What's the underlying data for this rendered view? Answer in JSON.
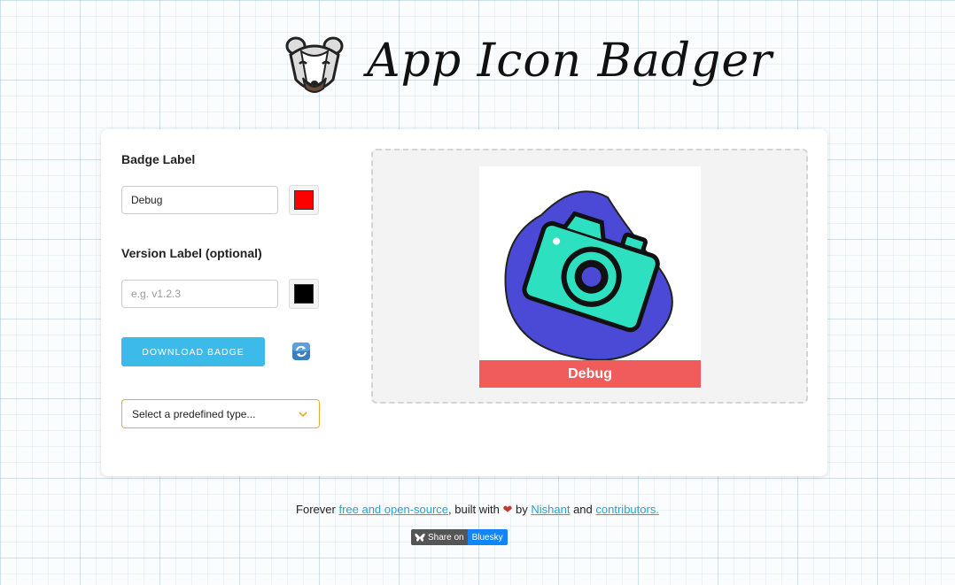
{
  "header": {
    "title": "App Icon Badger",
    "logo_icon": "badger-head-icon"
  },
  "form": {
    "badge_label_title": "Badge Label",
    "badge_label_value": "Debug",
    "badge_color": "#ff0000",
    "version_label_title": "Version Label (optional)",
    "version_placeholder": "e.g. v1.2.3",
    "version_color": "#000000",
    "download_label": "DOWNLOAD BADGE",
    "refresh_icon": "refresh-icon",
    "select_placeholder": "Select a predefined type...",
    "select_icon": "chevron-down-icon"
  },
  "preview": {
    "icon": "camera-icon",
    "blob_color": "#4a4ad6",
    "camera_color": "#2de0c0",
    "badge_text": "Debug",
    "badge_color": "#f05b5b"
  },
  "footer": {
    "prefix": "Forever",
    "link_oss": "free and open-source",
    "middle": ", built with",
    "by": "by",
    "author": "Nishant",
    "and": "and",
    "contributors": "contributors.",
    "share_left": "Share on",
    "share_right": "Bluesky"
  }
}
